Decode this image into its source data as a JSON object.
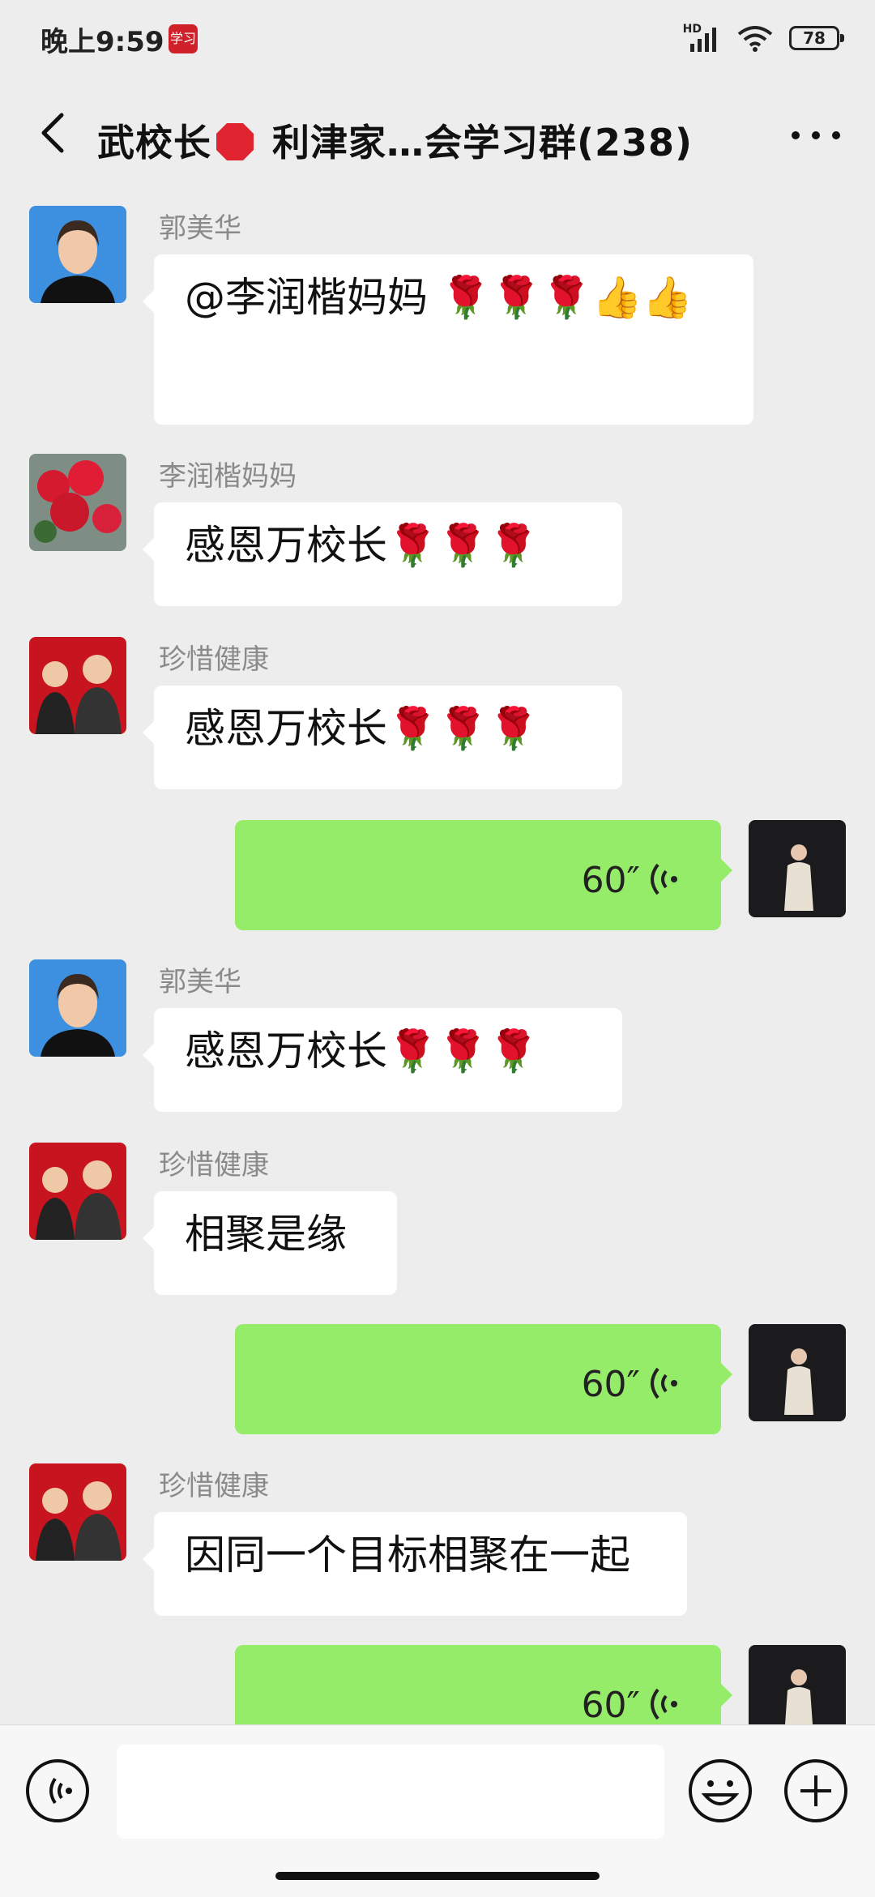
{
  "status_bar": {
    "time": "晚上9:59",
    "app_badge": "学习",
    "network": "HD",
    "battery": "78"
  },
  "header": {
    "title_prefix": "武校长",
    "title_suffix": " 利津家…会学习群(238)",
    "back_icon": "chevron-left-icon",
    "more_icon": "ellipsis-icon"
  },
  "messages": [
    {
      "direction": "in",
      "sender": "郭美华",
      "text": "@李润楷妈妈 🌹🌹🌹👍👍",
      "avatar": "woman-portrait-blue"
    },
    {
      "direction": "in",
      "sender": "李润楷妈妈",
      "text": "感恩万校长🌹🌹🌹",
      "avatar": "red-roses-photo"
    },
    {
      "direction": "in",
      "sender": "珍惜健康",
      "text": "感恩万校长🌹🌹🌹",
      "avatar": "father-son-red"
    },
    {
      "direction": "out",
      "voice_duration": "60″",
      "avatar": "woman-standing-dark"
    },
    {
      "direction": "in",
      "sender": "郭美华",
      "text": "感恩万校长🌹🌹🌹",
      "avatar": "woman-portrait-blue"
    },
    {
      "direction": "in",
      "sender": "珍惜健康",
      "text": "相聚是缘",
      "avatar": "father-son-red"
    },
    {
      "direction": "out",
      "voice_duration": "60″",
      "avatar": "woman-standing-dark"
    },
    {
      "direction": "in",
      "sender": "珍惜健康",
      "text": "因同一个目标相聚在一起",
      "avatar": "father-son-red"
    },
    {
      "direction": "out",
      "voice_duration": "60″",
      "avatar": "woman-standing-dark"
    }
  ],
  "input_bar": {
    "voice_icon": "voice-mode-icon",
    "emoji_icon": "emoji-icon",
    "plus_icon": "plus-icon",
    "text_value": ""
  },
  "colors": {
    "background": "#ededed",
    "incoming_bubble": "#ffffff",
    "outgoing_bubble": "#95ec69",
    "sender_name": "#8a8a8a"
  }
}
